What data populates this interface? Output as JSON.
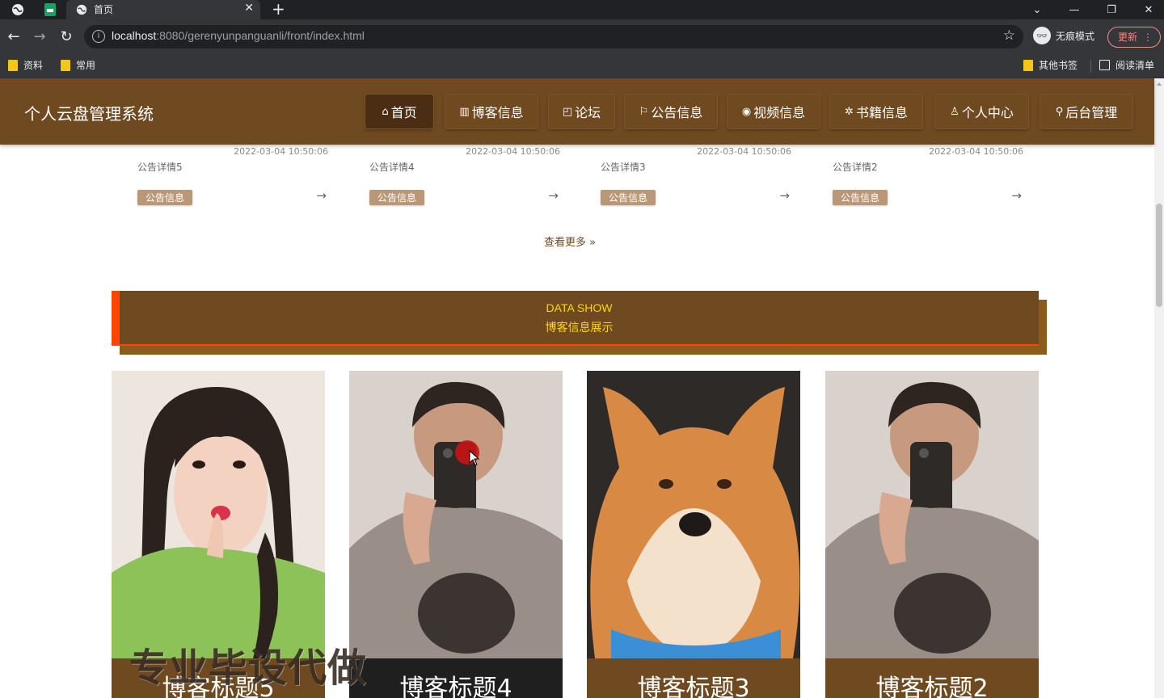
{
  "browser": {
    "tab_title": "首页",
    "url_host": "localhost",
    "url_path": ":8080/gerenyunpanguanli/front/index.html",
    "incognito_label": "无痕模式",
    "update_label": "更新",
    "bookmarks": [
      "资料",
      "常用"
    ],
    "other_bookmarks": "其他书签",
    "reading_list": "阅读清单"
  },
  "site": {
    "title": "个人云盘管理系统",
    "nav": [
      {
        "label": "首页",
        "icon": "⌂"
      },
      {
        "label": "博客信息",
        "icon": "▥"
      },
      {
        "label": "论坛",
        "icon": "◰"
      },
      {
        "label": "公告信息",
        "icon": "⚐"
      },
      {
        "label": "视频信息",
        "icon": "◉"
      },
      {
        "label": "书籍信息",
        "icon": "✲"
      },
      {
        "label": "个人中心",
        "icon": "♙"
      },
      {
        "label": "后台管理",
        "icon": "⚲"
      }
    ]
  },
  "notices": [
    {
      "date": "2022-03-04 10:50:06",
      "title": "公告详情5",
      "tag": "公告信息"
    },
    {
      "date": "2022-03-04 10:50:06",
      "title": "公告详情4",
      "tag": "公告信息"
    },
    {
      "date": "2022-03-04 10:50:06",
      "title": "公告详情3",
      "tag": "公告信息"
    },
    {
      "date": "2022-03-04 10:50:06",
      "title": "公告详情2",
      "tag": "公告信息"
    }
  ],
  "more_label": "查看更多",
  "section": {
    "en": "DATA SHOW",
    "cn": "博客信息展示"
  },
  "blogs": [
    {
      "title": "博客标题5"
    },
    {
      "title": "博客标题4"
    },
    {
      "title": "博客标题3"
    },
    {
      "title": "博客标题2"
    }
  ],
  "watermark": "专业毕设代做"
}
